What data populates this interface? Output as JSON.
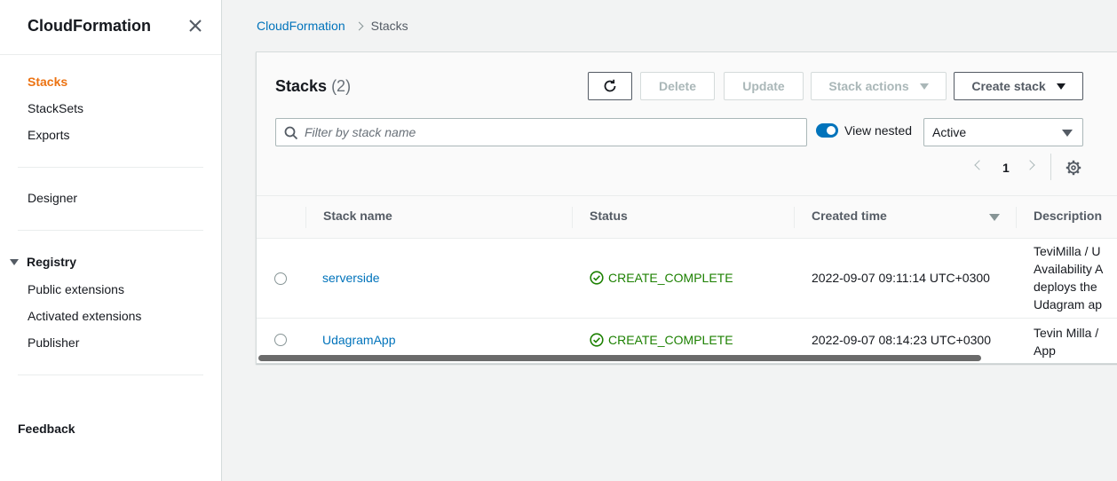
{
  "sidebar": {
    "title": "CloudFormation",
    "nav": [
      "Stacks",
      "StackSets",
      "Exports"
    ],
    "designer": "Designer",
    "registry": {
      "label": "Registry",
      "items": [
        "Public extensions",
        "Activated extensions",
        "Publisher"
      ]
    },
    "feedback": "Feedback"
  },
  "breadcrumb": {
    "root": "CloudFormation",
    "current": "Stacks"
  },
  "stacks_panel": {
    "title": "Stacks",
    "count": "(2)",
    "buttons": {
      "delete": "Delete",
      "update": "Update",
      "stack_actions": "Stack actions",
      "create_stack": "Create stack"
    },
    "filter_placeholder": "Filter by stack name",
    "view_nested_label": "View nested",
    "view_nested_on": true,
    "status_filter": "Active",
    "page": "1"
  },
  "table": {
    "columns": [
      "Stack name",
      "Status",
      "Created time",
      "Description"
    ],
    "rows": [
      {
        "name": "serverside",
        "status": "CREATE_COMPLETE",
        "created": "2022-09-07 09:11:14 UTC+0300",
        "description": "TeviMilla / U\nAvailability A\ndeploys the\nUdagram ap"
      },
      {
        "name": "UdagramApp",
        "status": "CREATE_COMPLETE",
        "created": "2022-09-07 08:14:23 UTC+0300",
        "description": "Tevin Milla /\nApp"
      }
    ]
  },
  "colors": {
    "accent_orange": "#ec7211",
    "link_blue": "#0073bb",
    "success_green": "#1d8102"
  }
}
